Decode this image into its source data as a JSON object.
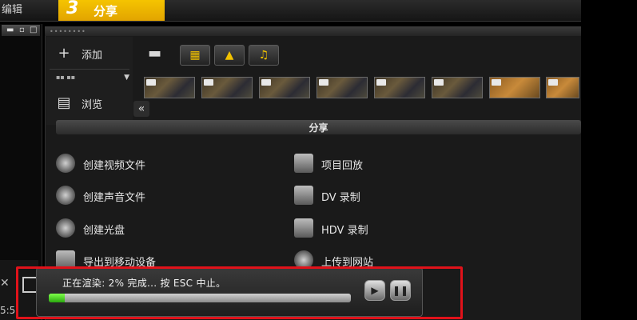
{
  "steps": {
    "prev_label": "编辑",
    "active_number": "3",
    "active_label": "分享"
  },
  "library": {
    "add_label": "添加",
    "browse_label": "浏览",
    "collapse_glyph": "«"
  },
  "share": {
    "section_title": "分享",
    "left_options": [
      {
        "label": "创建视频文件",
        "icon": "film-reel-icon"
      },
      {
        "label": "创建声音文件",
        "icon": "sound-wave-icon"
      },
      {
        "label": "创建光盘",
        "icon": "disc-icon"
      },
      {
        "label": "导出到移动设备",
        "icon": "mobile-device-icon"
      }
    ],
    "right_options": [
      {
        "label": "项目回放",
        "icon": "project-playback-icon"
      },
      {
        "label": "DV 录制",
        "icon": "dv-camera-icon"
      },
      {
        "label": "HDV 录制",
        "icon": "hdv-camera-icon"
      },
      {
        "label": "上传到网站",
        "icon": "globe-icon"
      }
    ]
  },
  "progress": {
    "status_text": "正在渲染:  2% 完成... 按 ESC 中止。",
    "percent": 2,
    "play_glyph": "▶",
    "pause_glyph": "❚❚"
  },
  "bottom_left": {
    "time_fragment": "5:5"
  },
  "colors": {
    "active_step": "#f5c400",
    "highlight_box": "#e0121a",
    "progress_fill": "#5ddc2e"
  }
}
